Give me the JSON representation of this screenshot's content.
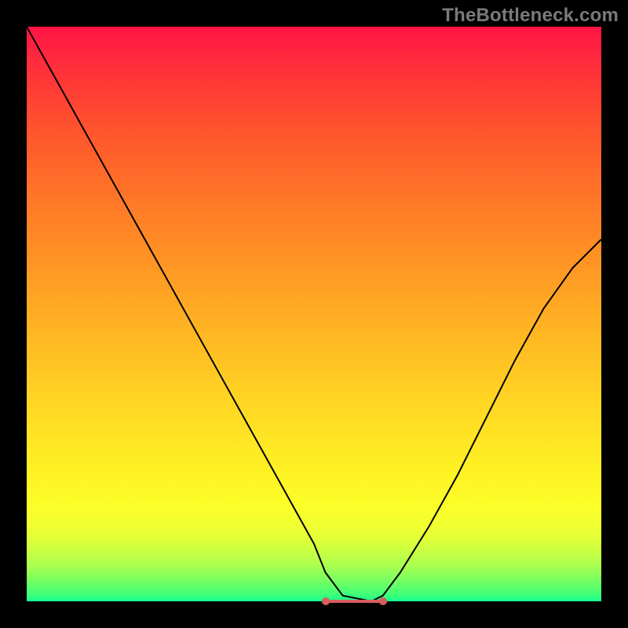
{
  "watermark": "TheBottleneck.com",
  "chart_data": {
    "type": "line",
    "title": "",
    "xlabel": "",
    "ylabel": "",
    "xlim": [
      0,
      100
    ],
    "ylim": [
      0,
      100
    ],
    "grid": false,
    "legend": false,
    "background_gradient": {
      "orientation": "vertical",
      "stops": [
        {
          "pos": 0,
          "color": "#ff1445"
        },
        {
          "pos": 50,
          "color": "#ffad23"
        },
        {
          "pos": 85,
          "color": "#f5ff2c"
        },
        {
          "pos": 100,
          "color": "#10ff92"
        }
      ]
    },
    "series": [
      {
        "name": "bottleneck-curve",
        "x": [
          0,
          5,
          10,
          15,
          20,
          25,
          30,
          35,
          40,
          45,
          50,
          52,
          55,
          60,
          62,
          65,
          70,
          75,
          80,
          85,
          90,
          95,
          100
        ],
        "values": [
          100,
          91,
          82,
          73,
          64,
          55,
          46,
          37,
          28,
          19,
          10,
          5,
          1,
          0,
          1,
          5,
          13,
          22,
          32,
          42,
          51,
          58,
          63
        ]
      }
    ],
    "annotations": {
      "optimal_range_x": [
        52,
        62
      ],
      "optimal_value": 0,
      "marker_color": "#d85d5d"
    }
  }
}
